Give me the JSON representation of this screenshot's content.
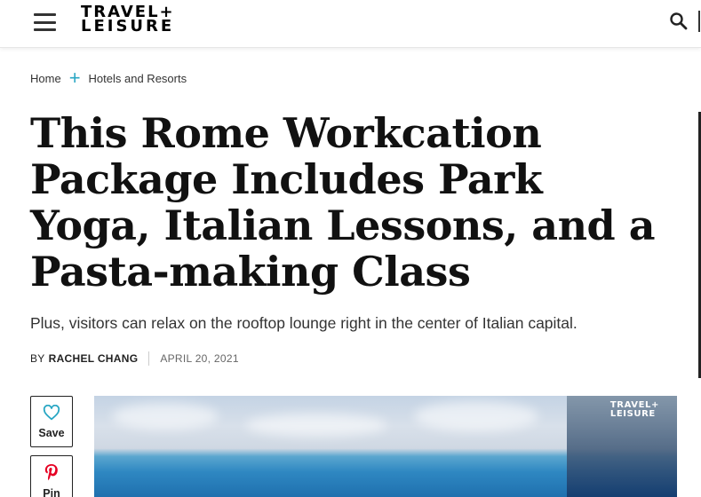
{
  "header": {
    "logo_line1": "TRAVEL+",
    "logo_line2": "LEISURE",
    "menu_icon": "hamburger-menu-icon",
    "search_icon": "search-icon"
  },
  "breadcrumb": {
    "home": "Home",
    "separator": "+",
    "section": "Hotels and Resorts"
  },
  "article": {
    "title": "This Rome Workcation Package Includes Park Yoga, Italian Lessons, and a Pasta-making Class",
    "dek": "Plus, visitors can relax on the rooftop lounge right in the center of Italian capital.",
    "by_prefix": "BY",
    "author": "RACHEL CHANG",
    "date": "APRIL 20, 2021"
  },
  "social": {
    "save_label": "Save",
    "save_icon": "heart-icon",
    "pin_label": "Pin",
    "pin_icon": "pinterest-icon"
  },
  "hero": {
    "watermark_line1": "TRAVEL+",
    "watermark_line2": "LEISURE"
  },
  "colors": {
    "accent": "#2aa7c4",
    "pinterest": "#e60023",
    "save_heart": "#2aa7c4"
  }
}
